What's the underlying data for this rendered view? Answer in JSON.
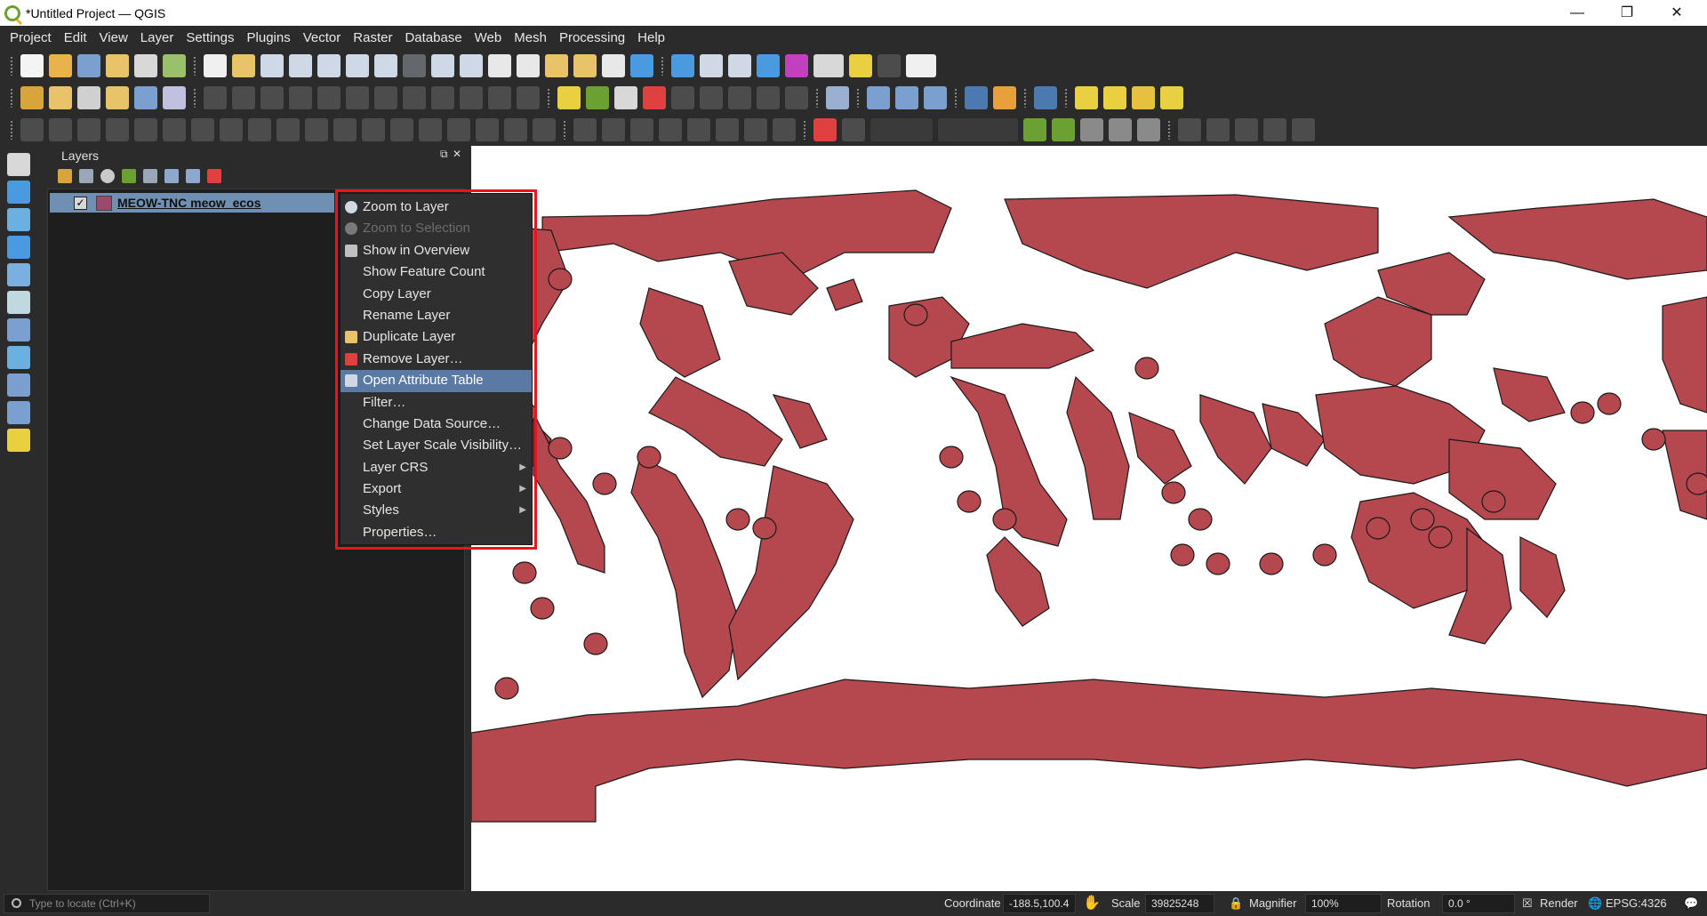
{
  "window": {
    "title": "*Untitled Project — QGIS",
    "minimize": "—",
    "restore": "❐",
    "close": "✕"
  },
  "menubar": [
    "Project",
    "Edit",
    "View",
    "Layer",
    "Settings",
    "Plugins",
    "Vector",
    "Raster",
    "Database",
    "Web",
    "Mesh",
    "Processing",
    "Help"
  ],
  "layers_panel": {
    "title": "Layers",
    "layer": {
      "name": "MEOW-TNC meow_ecos",
      "checked": "✓",
      "symbol_color": "#9b4a6b"
    }
  },
  "context_menu": {
    "items": [
      {
        "label": "Zoom to Layer",
        "icon": "zoom-layer-icon",
        "enabled": true
      },
      {
        "label": "Zoom to Selection",
        "icon": "zoom-selection-icon",
        "enabled": false
      },
      {
        "label": "Show in Overview",
        "icon": "overview-icon",
        "enabled": true
      },
      {
        "label": "Show Feature Count",
        "icon": "",
        "enabled": true
      },
      {
        "label": "Copy Layer",
        "icon": "",
        "enabled": true
      },
      {
        "label": "Rename Layer",
        "icon": "",
        "enabled": true
      },
      {
        "label": "Duplicate Layer",
        "icon": "duplicate-icon",
        "enabled": true
      },
      {
        "label": "Remove Layer…",
        "icon": "remove-icon",
        "enabled": true
      },
      {
        "label": "Open Attribute Table",
        "icon": "table-icon",
        "enabled": true,
        "active": true
      },
      {
        "label": "Filter…",
        "icon": "",
        "enabled": true
      },
      {
        "label": "Change Data Source…",
        "icon": "",
        "enabled": true
      },
      {
        "label": "Set Layer Scale Visibility…",
        "icon": "",
        "enabled": true
      },
      {
        "label": "Layer CRS",
        "icon": "",
        "enabled": true,
        "submenu": true
      },
      {
        "label": "Export",
        "icon": "",
        "enabled": true,
        "submenu": true
      },
      {
        "label": "Styles",
        "icon": "",
        "enabled": true,
        "submenu": true
      },
      {
        "label": "Properties…",
        "icon": "",
        "enabled": true
      }
    ],
    "submenu_arrow": "▶"
  },
  "map": {
    "fill_color": "#b5474e",
    "stroke_color": "#1a1a1a",
    "background": "#ffffff"
  },
  "statusbar": {
    "locator_placeholder": "Type to locate (Ctrl+K)",
    "coordinate_label": "Coordinate",
    "coordinate_value": "-188.5,100.4",
    "scale_label": "Scale",
    "scale_value": "39825248",
    "magnifier_label": "Magnifier",
    "magnifier_value": "100%",
    "rotation_label": "Rotation",
    "rotation_value": "0.0 °",
    "render_label": "Render",
    "crs_label": "EPSG:4326"
  },
  "colors": {
    "accent": "#5a7aa3",
    "highlight_box": "#e8141e",
    "toolbar_bg": "#2b2b2b"
  }
}
